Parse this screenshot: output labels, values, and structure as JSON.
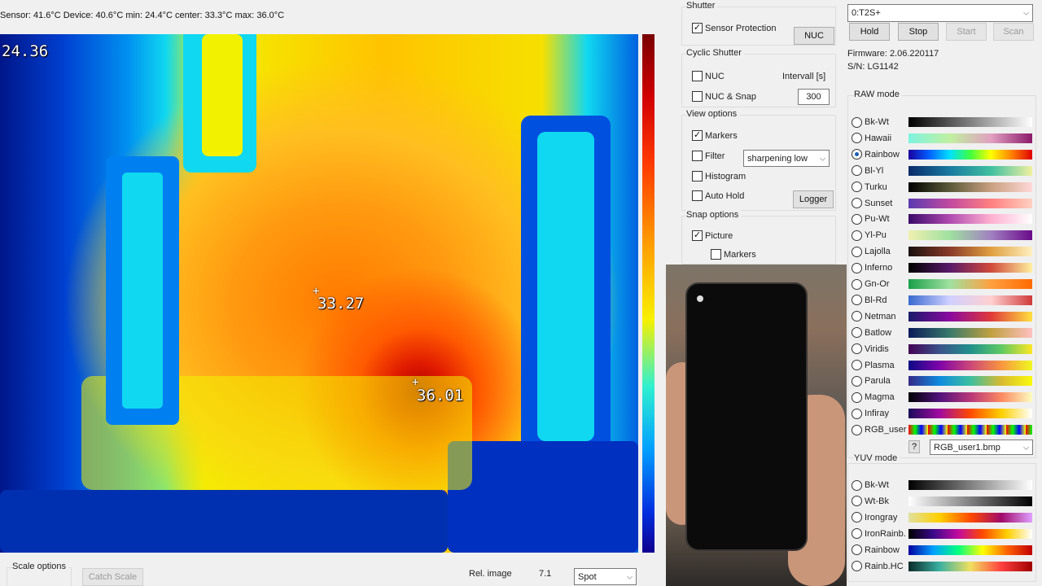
{
  "status": "Sensor: 41.6°C  Device: 40.6°C   min: 24.4°C  center: 33.3°C  max: 36.0°C",
  "thermal": {
    "min_label": "24.36",
    "center_label": "33.27",
    "max_label": "36.01",
    "crosshair": "+"
  },
  "shutter": {
    "title": "Shutter",
    "sensor_protection": "Sensor Protection",
    "nuc_button": "NUC"
  },
  "cyclic": {
    "title": "Cyclic Shutter",
    "nuc": "NUC",
    "interval_label": "Intervall [s]",
    "nuc_snap": "NUC & Snap",
    "interval_value": "300"
  },
  "view": {
    "title": "View options",
    "markers": "Markers",
    "filter": "Filter",
    "filter_value": "sharpening low",
    "histogram": "Histogram",
    "auto_hold": "Auto Hold",
    "logger": "Logger"
  },
  "snap": {
    "title": "Snap options",
    "picture": "Picture",
    "markers": "Markers"
  },
  "device": {
    "selected": "0:T2S+",
    "hold": "Hold",
    "stop": "Stop",
    "start": "Start",
    "scan": "Scan",
    "firmware": "Firmware: 2.06.220117",
    "serial": "S/N: LG1142"
  },
  "raw_mode": {
    "title": "RAW mode",
    "palettes": [
      {
        "name": "Bk-Wt",
        "selected": false
      },
      {
        "name": "Hawaii",
        "selected": false
      },
      {
        "name": "Rainbow",
        "selected": true
      },
      {
        "name": "Bl-Yl",
        "selected": false
      },
      {
        "name": "Turku",
        "selected": false
      },
      {
        "name": "Sunset",
        "selected": false
      },
      {
        "name": "Pu-Wt",
        "selected": false
      },
      {
        "name": "Yl-Pu",
        "selected": false
      },
      {
        "name": "Lajolla",
        "selected": false
      },
      {
        "name": "Inferno",
        "selected": false
      },
      {
        "name": "Gn-Or",
        "selected": false
      },
      {
        "name": "Bl-Rd",
        "selected": false
      },
      {
        "name": "Netman",
        "selected": false
      },
      {
        "name": "Batlow",
        "selected": false
      },
      {
        "name": "Viridis",
        "selected": false
      },
      {
        "name": "Plasma",
        "selected": false
      },
      {
        "name": "Parula",
        "selected": false
      },
      {
        "name": "Magma",
        "selected": false
      },
      {
        "name": "Infiray",
        "selected": false
      },
      {
        "name": "RGB_user",
        "selected": false
      }
    ],
    "help_button": "?",
    "user_file": "RGB_user1.bmp"
  },
  "yuv_mode": {
    "title": "YUV mode",
    "palettes": [
      {
        "name": "Bk-Wt",
        "selected": false
      },
      {
        "name": "Wt-Bk",
        "selected": false
      },
      {
        "name": "Irongray",
        "selected": false
      },
      {
        "name": "IronRainb.",
        "selected": false
      },
      {
        "name": "Rainbow",
        "selected": false
      },
      {
        "name": "Rainb.HC",
        "selected": false
      }
    ]
  },
  "bottom": {
    "scale_options": "Scale options",
    "catch_scale": "Catch Scale",
    "rel_image": "Rel. image",
    "rel_value": "7.1",
    "mode": "Spot"
  },
  "colors": {
    "selected_radio": "#1a5fb4",
    "panel_bg": "#f0f0f0"
  }
}
